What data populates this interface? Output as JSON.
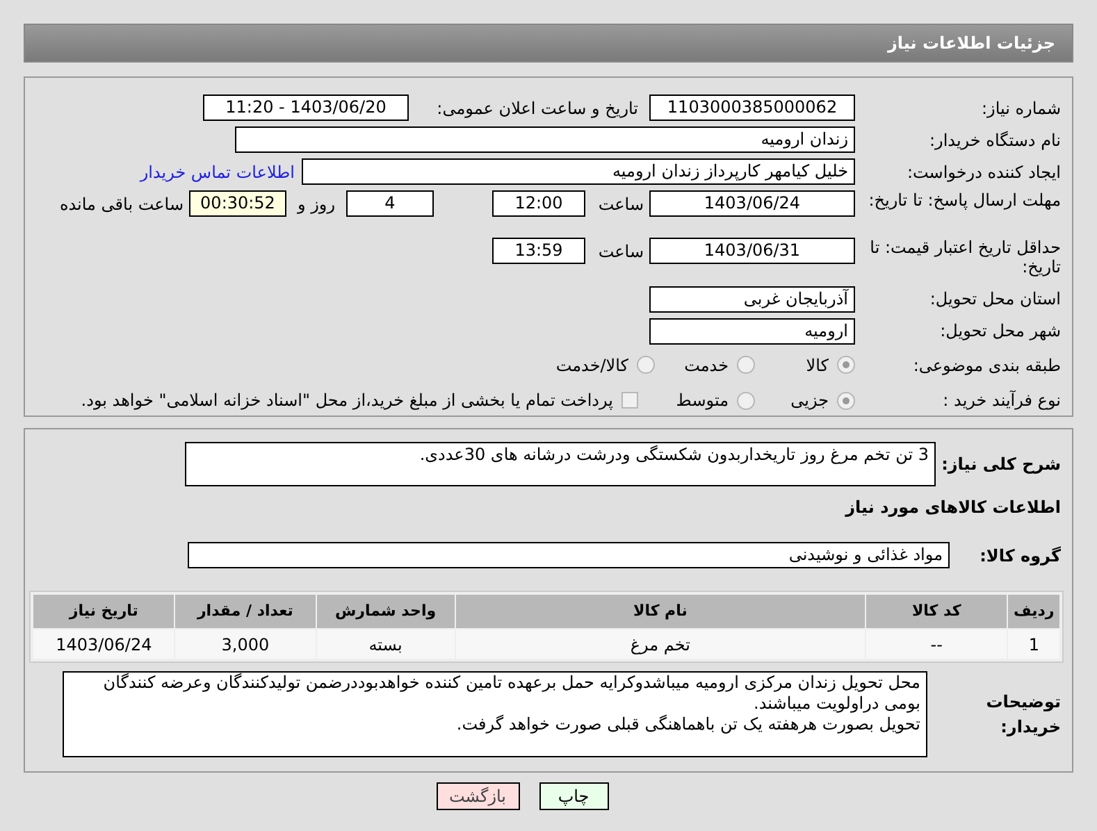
{
  "header": {
    "title": "جزئیات اطلاعات نیاز"
  },
  "details": {
    "need_number": {
      "label": "شماره نیاز:",
      "value": "1103000385000062"
    },
    "announce": {
      "label": "تاریخ و ساعت اعلان عمومی:",
      "value": "1403/06/20 - 11:20"
    },
    "buyer_org": {
      "label": "نام دستگاه خریدار:",
      "value": "زندان ارومیه"
    },
    "requester": {
      "label": "ایجاد کننده درخواست:",
      "value": "خلیل کیامهر کارپرداز زندان ارومیه",
      "link": "اطلاعات تماس خریدار"
    },
    "reply_deadline": {
      "label": "مهلت ارسال پاسخ: تا تاریخ:",
      "date": "1403/06/24",
      "time_label": "ساعت",
      "time": "12:00",
      "days": "4",
      "days_label": "روز و",
      "remaining": "00:30:52",
      "remaining_label": "ساعت باقی مانده"
    },
    "price_validity": {
      "label": "حداقل تاریخ اعتبار قیمت: تا تاریخ:",
      "date": "1403/06/31",
      "time_label": "ساعت",
      "time": "13:59"
    },
    "province": {
      "label": "استان محل تحویل:",
      "value": "آذربایجان غربی"
    },
    "city": {
      "label": "شهر محل تحویل:",
      "value": "ارومیه"
    },
    "category": {
      "label": "طبقه بندی موضوعی:",
      "options": [
        {
          "label": "کالا",
          "selected": true
        },
        {
          "label": "خدمت",
          "selected": false
        },
        {
          "label": "کالا/خدمت",
          "selected": false
        }
      ]
    },
    "process": {
      "label": "نوع فرآیند خرید :",
      "options": [
        {
          "label": "جزیی",
          "selected": true
        },
        {
          "label": "متوسط",
          "selected": false
        }
      ],
      "treasury": {
        "checked": false,
        "text": "پرداخت تمام یا بخشی از مبلغ خرید،از محل \"اسناد خزانه اسلامی\" خواهد بود."
      }
    }
  },
  "goods": {
    "summary": {
      "label": "شرح کلی نیاز:",
      "value": "3 تن تخم مرغ روز تاریخداربدون شکستگی ودرشت درشانه های 30عددی."
    },
    "heading": "اطلاعات کالاهای مورد نیاز",
    "group": {
      "label": "گروه کالا:",
      "value": "مواد غذائی و نوشیدنی"
    },
    "table": {
      "columns": [
        "ردیف",
        "کد کالا",
        "نام کالا",
        "واحد شمارش",
        "تعداد / مقدار",
        "تاریخ نیاز"
      ],
      "rows": [
        [
          "1",
          "--",
          "تخم مرغ",
          "بسته",
          "3,000",
          "1403/06/24"
        ]
      ]
    },
    "buyer_notes": {
      "label": "توضیحات خریدار:",
      "lines": [
        "محل تحویل زندان مرکزی ارومیه میباشدوکرایه حمل برعهده تامین کننده خواهدبوددرضمن تولیدکنندگان وعرضه کنندگان بومی دراولویت میباشند.",
        "تحویل بصورت هرهفته یک تن باهماهنگی قبلی صورت خواهد گرفت."
      ]
    }
  },
  "buttons": [
    {
      "label": "چاپ",
      "kind": "print"
    },
    {
      "label": "بازگشت",
      "kind": "back"
    }
  ]
}
